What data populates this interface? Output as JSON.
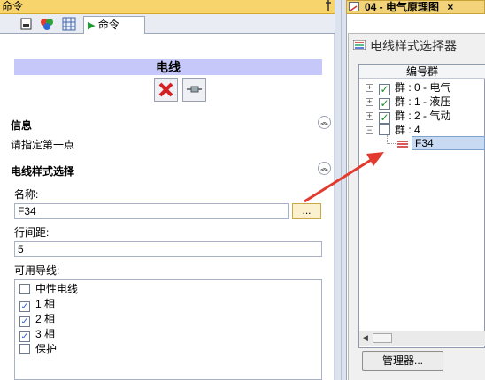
{
  "left_panel": {
    "title": "命令",
    "pin": "↓",
    "tab_label": "命令",
    "heading": "电线",
    "info": {
      "title": "信息",
      "message": "请指定第一点"
    },
    "style_section": {
      "title": "电线样式选择",
      "name_label": "名称:",
      "name_value": "F34",
      "browse_label": "...",
      "spacing_label": "行间距:",
      "spacing_value": "5",
      "wires_label": "可用导线:",
      "wires": [
        {
          "label": "中性电线",
          "checked": false
        },
        {
          "label": "1 相",
          "checked": true
        },
        {
          "label": "2 相",
          "checked": true
        },
        {
          "label": "3 相",
          "checked": true
        },
        {
          "label": "保护",
          "checked": false
        }
      ]
    }
  },
  "right_panel": {
    "doc_tab": "04 - 电气原理图",
    "close": "×",
    "dialog_title": "电线样式选择器",
    "tree_header": "编号群",
    "groups": [
      {
        "label": "群 : 0 - 电气",
        "checked": true
      },
      {
        "label": "群 : 1 - 液压",
        "checked": true
      },
      {
        "label": "群 : 2 - 气动",
        "checked": true
      },
      {
        "label": "群 : 4",
        "checked": false
      }
    ],
    "child_item": "F34",
    "manager_button": "管理器..."
  },
  "colors": {
    "title_bar": "#f7d56c",
    "heading_bar": "#c5c8f8",
    "arrow": "#e23a2e",
    "selection": "#c8d9f2"
  }
}
